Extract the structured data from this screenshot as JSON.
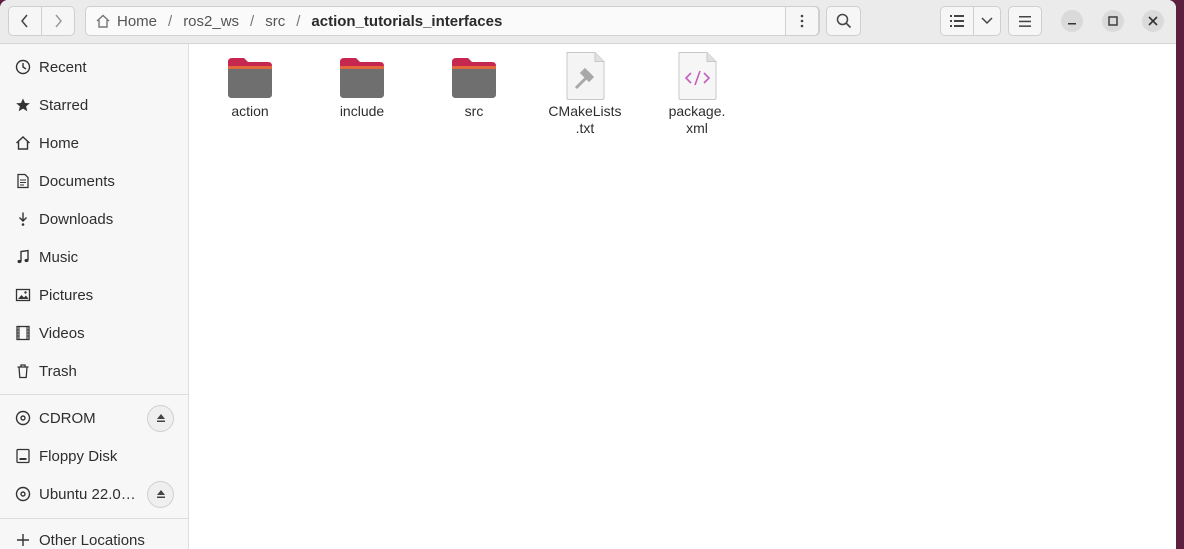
{
  "header": {
    "path": [
      "Home",
      "ros2_ws",
      "src",
      "action_tutorials_interfaces"
    ]
  },
  "sidebar": {
    "places": [
      {
        "label": "Recent",
        "icon": "clock-icon"
      },
      {
        "label": "Starred",
        "icon": "star-icon"
      },
      {
        "label": "Home",
        "icon": "home-icon"
      },
      {
        "label": "Documents",
        "icon": "document-icon"
      },
      {
        "label": "Downloads",
        "icon": "download-icon"
      },
      {
        "label": "Music",
        "icon": "music-icon"
      },
      {
        "label": "Pictures",
        "icon": "picture-icon"
      },
      {
        "label": "Videos",
        "icon": "video-icon"
      },
      {
        "label": "Trash",
        "icon": "trash-icon"
      }
    ],
    "devices": [
      {
        "label": "CDROM",
        "icon": "disc-icon",
        "eject": true
      },
      {
        "label": "Floppy Disk",
        "icon": "drive-icon",
        "eject": false
      },
      {
        "label": "Ubuntu 22.0…",
        "icon": "disc-icon",
        "eject": true
      }
    ],
    "other": {
      "label": "Other Locations",
      "icon": "plus-icon"
    }
  },
  "files": [
    {
      "name": "action",
      "type": "folder"
    },
    {
      "name": "include",
      "type": "folder"
    },
    {
      "name": "src",
      "type": "folder"
    },
    {
      "name": "CMakeLists\n.txt",
      "type": "cmake"
    },
    {
      "name": "package.\nxml",
      "type": "xml"
    }
  ],
  "colors": {
    "folder_top": "#c5274f",
    "folder_body": "#6f6f6f",
    "accent": "#e95420"
  }
}
